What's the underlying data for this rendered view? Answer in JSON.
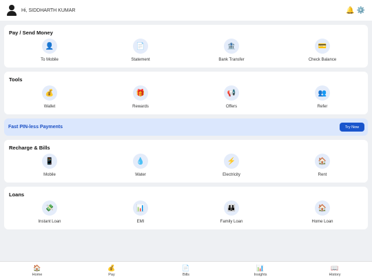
{
  "header": {
    "greeting": "Hi, SIDDHARTH KUMAR",
    "icons": {
      "notifications": "🔔",
      "settings": "⚙️"
    }
  },
  "sections": [
    {
      "title": "Pay / Send Money",
      "items": [
        {
          "label": "To Mobile",
          "icon": "👤"
        },
        {
          "label": "Statement",
          "icon": "📄"
        },
        {
          "label": "Bank Transfer",
          "icon": "🏦"
        },
        {
          "label": "Check Balance",
          "icon": "💳"
        }
      ]
    },
    {
      "title": "Tools",
      "items": [
        {
          "label": "Wallet",
          "icon": "💰"
        },
        {
          "label": "Rewards",
          "icon": "🎁"
        },
        {
          "label": "Offers",
          "icon": "📢"
        },
        {
          "label": "Refer",
          "icon": "👥"
        }
      ]
    },
    {
      "title": "Recharge & Bills",
      "items": [
        {
          "label": "Mobile",
          "icon": "📱"
        },
        {
          "label": "Water",
          "icon": "💧"
        },
        {
          "label": "Electricity",
          "icon": "⚡"
        },
        {
          "label": "Rent",
          "icon": "🏠"
        }
      ]
    },
    {
      "title": "Loans",
      "items": [
        {
          "label": "Instant Loan",
          "icon": "💸"
        },
        {
          "label": "EMI",
          "icon": "📊"
        },
        {
          "label": "Family Loan",
          "icon": "👪"
        },
        {
          "label": "Home Loan",
          "icon": "🏠"
        }
      ]
    }
  ],
  "promo": {
    "text": "Fast PIN-less Payments",
    "button": "Try Now"
  },
  "bottom_nav": [
    {
      "label": "Home",
      "icon": "🏠"
    },
    {
      "label": "Pay",
      "icon": "💰"
    },
    {
      "label": "Bills",
      "icon": "📄"
    },
    {
      "label": "Insights",
      "icon": "📊"
    },
    {
      "label": "History",
      "icon": "📖"
    }
  ]
}
